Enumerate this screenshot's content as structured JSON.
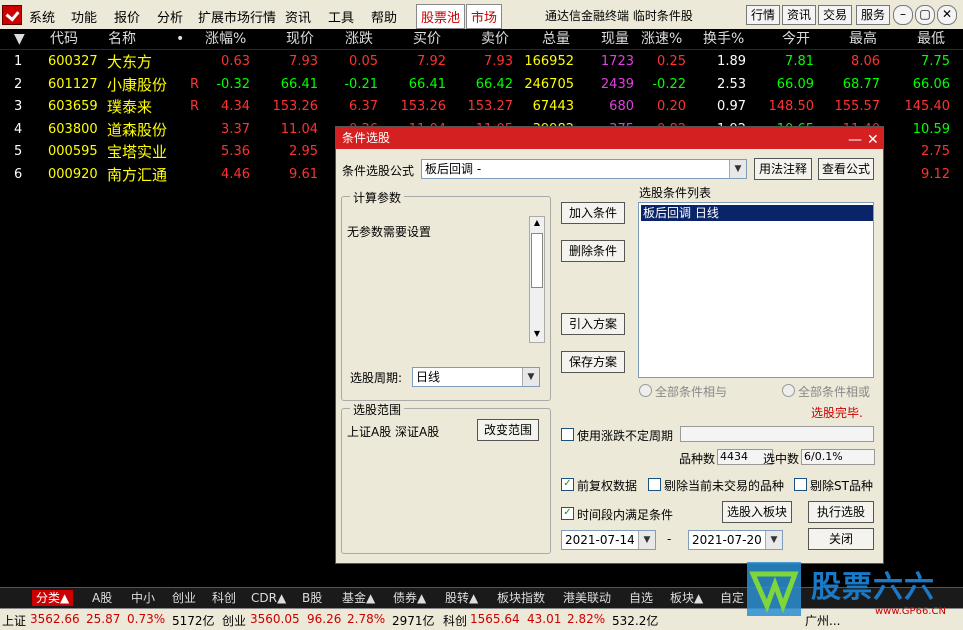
{
  "menubar": {
    "items": [
      "系统",
      "功能",
      "报价",
      "分析",
      "扩展市场行情",
      "资讯",
      "工具",
      "帮助"
    ],
    "highlighted": [
      "股票池",
      "市场"
    ],
    "title": "通达信金融终端  临时条件股",
    "right_buttons": [
      "行情",
      "资讯",
      "交易",
      "服务"
    ]
  },
  "grid": {
    "headers": [
      "代码",
      "名称",
      "•",
      "涨幅%",
      "现价",
      "涨跌",
      "买价",
      "卖价",
      "总量",
      "现量",
      "涨速%",
      "换手%",
      "今开",
      "最高",
      "最低"
    ],
    "rows": [
      {
        "idx": "1",
        "code": "600327",
        "name": "大东方",
        "flag": "",
        "pct": "0.63",
        "price": "7.93",
        "chg": "0.05",
        "bid": "7.92",
        "ask": "7.93",
        "vol": "166952",
        "cur": "1723",
        "speed": "0.25",
        "turn": "1.89",
        "open": "7.81",
        "high": "8.06",
        "low": "7.75"
      },
      {
        "idx": "2",
        "code": "601127",
        "name": "小康股份",
        "flag": "R",
        "pct": "-0.32",
        "price": "66.41",
        "chg": "-0.21",
        "bid": "66.41",
        "ask": "66.42",
        "vol": "246705",
        "cur": "2439",
        "speed": "-0.22",
        "turn": "2.53",
        "open": "66.09",
        "high": "68.77",
        "low": "66.06"
      },
      {
        "idx": "3",
        "code": "603659",
        "name": "璞泰来",
        "flag": "R",
        "pct": "4.34",
        "price": "153.26",
        "chg": "6.37",
        "bid": "153.26",
        "ask": "153.27",
        "vol": "67443",
        "cur": "680",
        "speed": "0.20",
        "turn": "0.97",
        "open": "148.50",
        "high": "155.57",
        "low": "145.40"
      },
      {
        "idx": "4",
        "code": "603800",
        "name": "道森股份",
        "flag": "",
        "pct": "3.37",
        "price": "11.04",
        "chg": "0.36",
        "bid": "11.04",
        "ask": "11.05",
        "vol": "39982",
        "cur": "375",
        "speed": "0.82",
        "turn": "1.92",
        "open": "10.65",
        "high": "11.40",
        "low": "10.59"
      },
      {
        "idx": "5",
        "code": "000595",
        "name": "宝塔实业",
        "flag": "",
        "pct": "5.36",
        "price": "2.95",
        "chg": "",
        "bid": "",
        "ask": "",
        "vol": "",
        "cur": "",
        "speed": "",
        "turn": "",
        "open": "",
        "high": "",
        "low": "2.75"
      },
      {
        "idx": "6",
        "code": "000920",
        "name": "南方汇通",
        "flag": "",
        "pct": "4.46",
        "price": "9.61",
        "chg": "",
        "bid": "",
        "ask": "",
        "vol": "",
        "cur": "",
        "speed": "",
        "turn": "",
        "open": "",
        "high": "",
        "low": "9.12"
      }
    ]
  },
  "dialog": {
    "title": "条件选股",
    "formula_label": "条件选股公式",
    "formula_value": "板后回调        -",
    "usage_btn": "用法注释",
    "view_formula_btn": "查看公式",
    "params_group": "计算参数",
    "params_text": "无参数需要设置",
    "period_label": "选股周期:",
    "period_value": "日线",
    "add_btn": "加入条件",
    "delete_btn": "删除条件",
    "import_btn": "引入方案",
    "save_btn": "保存方案",
    "cond_list_label": "选股条件列表",
    "cond_item": "板后回调   日线",
    "radio_and": "全部条件相与",
    "radio_or": "全部条件相或",
    "done_text": "选股完毕.",
    "range_group": "选股范围",
    "range_text": "上证A股  深证A股",
    "change_range_btn": "改变范围",
    "use_period": "使用涨跌不定周期",
    "count_label": "品种数",
    "count_value": "4434",
    "selected_label": "选中数",
    "selected_value": "6/0.1%",
    "pre_adjust": "前复权数据",
    "exclude_untraded": "剔除当前未交易的品种",
    "exclude_st": "剔除ST品种",
    "time_range": "时间段内满足条件",
    "to_block_btn": "选股入板块",
    "run_btn": "执行选股",
    "date_from": "2021-07-14",
    "date_sep": "-",
    "date_to": "2021-07-20",
    "close_btn": "关闭"
  },
  "tabs": [
    "分类▲",
    "A股",
    "中小",
    "创业",
    "科创",
    "CDR▲",
    "B股",
    "基金▲",
    "债券▲",
    "股转▲",
    "板块指数",
    "港美联动",
    "自选",
    "板块▲",
    "自定"
  ],
  "status": {
    "sh_label": "上证",
    "sh_val": "3562.66",
    "sh_chg": "25.87",
    "sh_pct": "0.73%",
    "sh_amt": "5172亿",
    "cy_label": "创业",
    "cy_val": "3560.05",
    "cy_chg": "96.26",
    "cy_pct": "2.78%",
    "cy_amt": "2971亿",
    "kc_label": "科创",
    "kc_val": "1565.64",
    "kc_chg": "43.01",
    "kc_pct": "2.82%",
    "kc_amt": "532.2亿",
    "city": "广州..."
  },
  "watermark": {
    "brand": "股票六六",
    "url": "www.GP66.CN"
  }
}
